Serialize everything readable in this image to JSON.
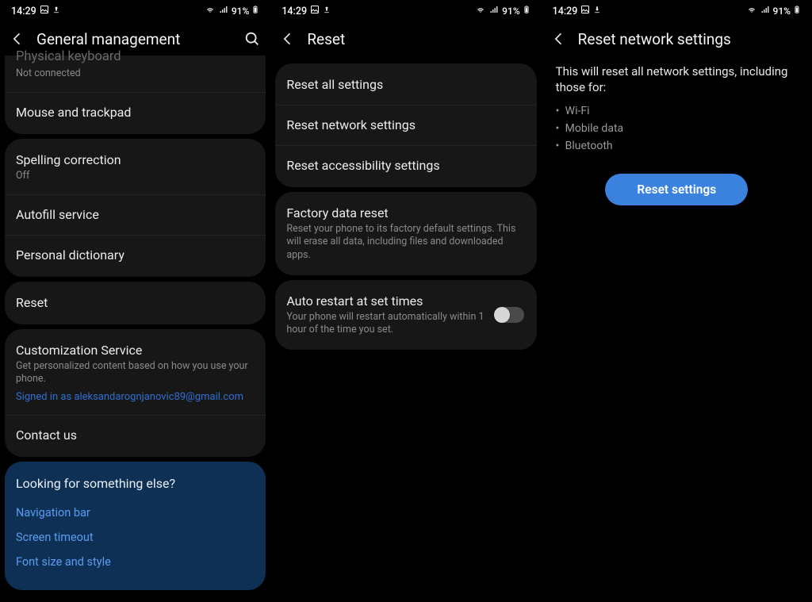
{
  "status": {
    "time": "14:29",
    "battery_pct": "91%"
  },
  "screen1": {
    "header_title": "General management",
    "physical_keyboard": {
      "title": "Physical keyboard",
      "sub": "Not connected"
    },
    "mouse_trackpad": "Mouse and trackpad",
    "spelling": {
      "title": "Spelling correction",
      "sub": "Off"
    },
    "autofill": "Autofill service",
    "personal_dict": "Personal dictionary",
    "reset": "Reset",
    "customization": {
      "title": "Customization Service",
      "sub": "Get personalized content based on how you use your phone.",
      "link": "Signed in as aleksandarognjanovic89@gmail.com"
    },
    "contact_us": "Contact us",
    "lfse": {
      "header": "Looking for something else?",
      "links": [
        "Navigation bar",
        "Screen timeout",
        "Font size and style"
      ]
    }
  },
  "screen2": {
    "header_title": "Reset",
    "reset_all": "Reset all settings",
    "reset_network": "Reset network settings",
    "reset_accessibility": "Reset accessibility settings",
    "factory": {
      "title": "Factory data reset",
      "sub": "Reset your phone to its factory default settings. This will erase all data, including files and downloaded apps."
    },
    "auto_restart": {
      "title": "Auto restart at set times",
      "sub": "Your phone will restart automatically within 1 hour of the time you set."
    }
  },
  "screen3": {
    "header_title": "Reset network settings",
    "desc": "This will reset all network settings, including those for:",
    "bullets": [
      "Wi-Fi",
      "Mobile data",
      "Bluetooth"
    ],
    "button": "Reset settings"
  }
}
